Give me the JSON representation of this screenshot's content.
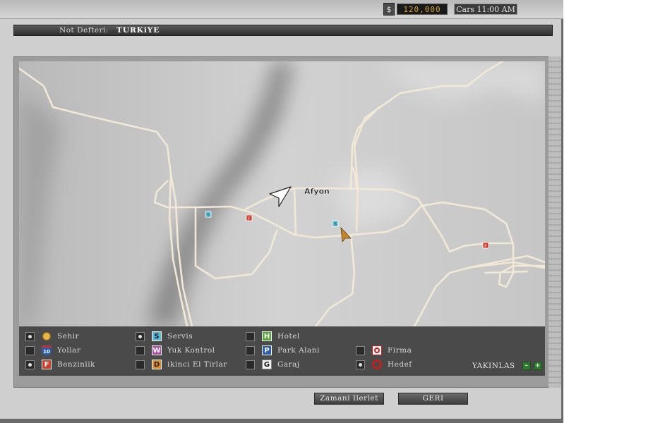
{
  "status_bar": {
    "currency_symbol": "$",
    "money": "120,000",
    "clock": "Cars 11:00 AM"
  },
  "notebook": {
    "label": "Not Defteri:",
    "value": "TURKiYE"
  },
  "map": {
    "city_label": "Afyon"
  },
  "legend": {
    "items": [
      {
        "label": "Sehir",
        "checked": true,
        "icon": "city-dot-icon"
      },
      {
        "label": "Yollar",
        "checked": false,
        "icon": "road-shield-icon",
        "glyph": "10"
      },
      {
        "label": "Benzinlik",
        "checked": true,
        "icon": "fuel-station-icon",
        "glyph": "F"
      },
      {
        "label": "Servis",
        "checked": true,
        "icon": "service-icon",
        "glyph": "S"
      },
      {
        "label": "Yuk Kontrol",
        "checked": false,
        "icon": "weigh-station-icon",
        "glyph": "W"
      },
      {
        "label": "ikinci El Tirlar",
        "checked": false,
        "icon": "used-trucks-icon",
        "glyph": "D"
      },
      {
        "label": "Hotel",
        "checked": false,
        "icon": "hotel-icon",
        "glyph": "H"
      },
      {
        "label": "Park Alani",
        "checked": false,
        "icon": "parking-icon",
        "glyph": "P"
      },
      {
        "label": "Garaj",
        "checked": false,
        "icon": "garage-icon",
        "glyph": "G"
      },
      {
        "label": "Firma",
        "checked": false,
        "icon": "company-icon"
      },
      {
        "label": "Hedef",
        "checked": true,
        "icon": "target-ring-icon"
      }
    ],
    "zoom_label": "YAKINLAS",
    "zoom_out": "–",
    "zoom_in": "+"
  },
  "buttons": {
    "advance_time": "Zamani Ilerlet",
    "back": "GERI"
  },
  "colors": {
    "road": "#f2e8d6",
    "money_text": "#d9a235",
    "fuel": "#d23a2a",
    "service": "#5bbcd6",
    "hotel": "#5aa83a",
    "parking": "#2a5fb0",
    "weigh": "#b04aa8",
    "used": "#e08a2a"
  }
}
